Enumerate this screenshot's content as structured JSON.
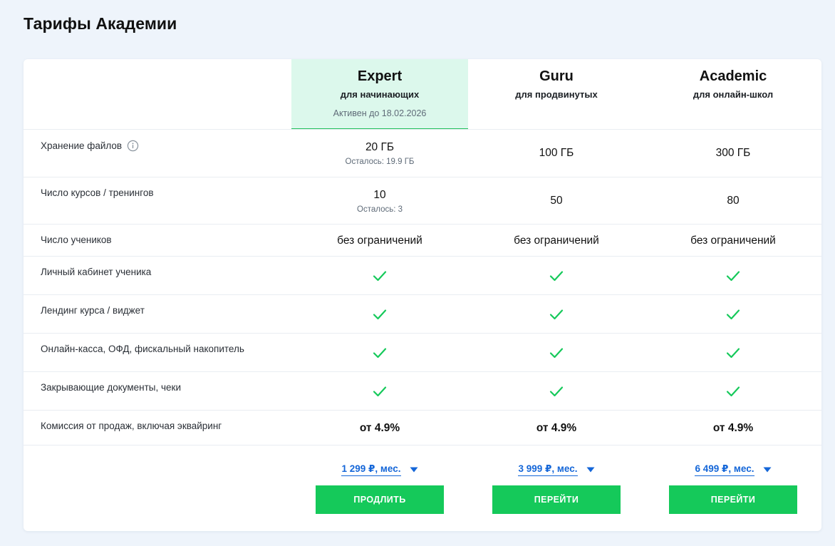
{
  "page": {
    "title": "Тарифы Академии"
  },
  "plans": [
    {
      "name": "Expert",
      "subtitle": "для начинающих",
      "active_until": "Активен до 18.02.2026"
    },
    {
      "name": "Guru",
      "subtitle": "для продвинутых"
    },
    {
      "name": "Academic",
      "subtitle": "для онлайн-школ"
    }
  ],
  "features": {
    "storage": {
      "label": "Хранение файлов",
      "values": [
        "20 ГБ",
        "100 ГБ",
        "300 ГБ"
      ],
      "remaining": "Осталось: 19.9 ГБ"
    },
    "courses": {
      "label": "Число курсов / тренингов",
      "values": [
        "10",
        "50",
        "80"
      ],
      "remaining": "Осталось: 3"
    },
    "students": {
      "label": "Число учеников",
      "values": [
        "без ограничений",
        "без ограничений",
        "без ограничений"
      ]
    },
    "cabinet": {
      "label": "Личный кабинет ученика"
    },
    "landing": {
      "label": "Лендинг курса / виджет"
    },
    "kassa": {
      "label": "Онлайн-касса, ОФД, фискальный накопитель"
    },
    "docs": {
      "label": "Закрывающие документы, чеки"
    },
    "commission": {
      "label": "Комиссия от продаж, включая эквайринг",
      "values": [
        "от 4.9%",
        "от 4.9%",
        "от 4.9%"
      ]
    }
  },
  "prices": [
    "1 299 ₽, мес.",
    "3 999 ₽, мес.",
    "6 499 ₽, мес."
  ],
  "buttons": [
    "ПРОДЛИТЬ",
    "ПЕРЕЙТИ",
    "ПЕРЕЙТИ"
  ],
  "icons": {
    "info": "info-icon",
    "check": "check-icon",
    "caret": "caret-down-icon"
  },
  "colors": {
    "accent_green": "#15c95a",
    "active_bg": "#dcf8ec",
    "link_blue": "#1466d8"
  }
}
